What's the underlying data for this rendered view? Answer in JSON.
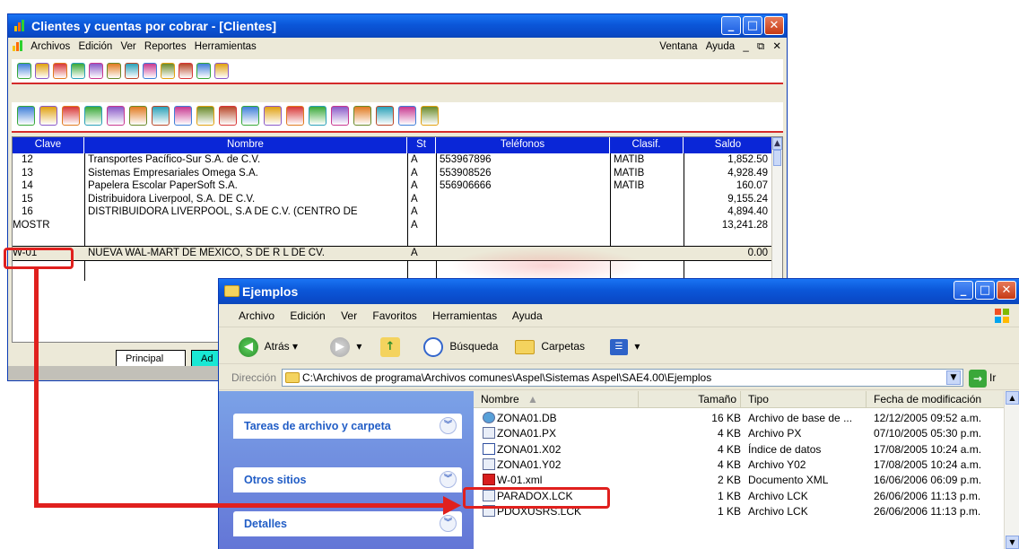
{
  "app_window": {
    "title": "Clientes y cuentas por cobrar - [Clientes]",
    "controls": [
      "_",
      "□",
      "✕"
    ],
    "menu": [
      "Archivos",
      "Edición",
      "Ver",
      "Reportes",
      "Herramientas"
    ],
    "menu_right": [
      "Ventana",
      "Ayuda",
      "_",
      "⧉",
      "✕"
    ],
    "toolbar1_icons": [
      "clients-icon",
      "report-icon",
      "user-money-icon",
      "doc-icon",
      "doc-money-icon",
      "transfer-icon",
      "pos-icon",
      "user-icon",
      "gear-icon",
      "book-icon",
      "user-alert-icon",
      "exit-icon"
    ],
    "toolbar2_icons": [
      "new-icon",
      "edit-icon",
      "delete-icon",
      "search-icon",
      "filter-icon",
      "refresh-icon",
      "print-icon",
      "preview-icon",
      "report-icon",
      "user-money-icon",
      "cancel-icon",
      "money-icon",
      "sum-icon",
      "next-icon",
      "relations-icon",
      "user-icon",
      "import-icon",
      "export-icon",
      "notes-icon"
    ],
    "table": {
      "columns": [
        "Clave",
        "Nombre",
        "St",
        "Teléfonos",
        "Clasif.",
        "Saldo"
      ],
      "rows": [
        {
          "clave": "12",
          "nombre": "Transportes Pacífico-Sur S.A. de C.V.",
          "st": "A",
          "tel": "553967896",
          "clasif": "MATIB",
          "saldo": "1,852.50"
        },
        {
          "clave": "13",
          "nombre": "Sistemas Empresariales Omega S.A.",
          "st": "A",
          "tel": "553908526",
          "clasif": "MATIB",
          "saldo": "4,928.49"
        },
        {
          "clave": "14",
          "nombre": "Papelera Escolar PaperSoft S.A.",
          "st": "A",
          "tel": "556906666",
          "clasif": "MATIB",
          "saldo": "160.07"
        },
        {
          "clave": "15",
          "nombre": "Distribuidora Liverpool, S.A. DE C.V.",
          "st": "A",
          "tel": "",
          "clasif": "",
          "saldo": "9,155.24"
        },
        {
          "clave": "16",
          "nombre": "DISTRIBUIDORA LIVERPOOL, S.A DE C.V. (CENTRO DE",
          "st": "A",
          "tel": "",
          "clasif": "",
          "saldo": "4,894.40"
        },
        {
          "clave": "MOSTR",
          "nombre": "",
          "st": "A",
          "tel": "",
          "clasif": "",
          "saldo": "13,241.28"
        },
        {
          "clave": "W-01",
          "nombre": "NUEVA WAL-MART DE MEXICO, S DE R L DE CV.",
          "st": "A",
          "tel": "",
          "clasif": "",
          "saldo": "0.00"
        }
      ]
    },
    "tabs": [
      "Principal",
      "Ad"
    ],
    "colors": {
      "header_bg": "#0a26d7",
      "active_tab": "#19e8d4",
      "toolbar_rule": "#d32b2b"
    }
  },
  "explorer": {
    "title": "Ejemplos",
    "controls": [
      "_",
      "□",
      "✕"
    ],
    "menu": [
      "Archivo",
      "Edición",
      "Ver",
      "Favoritos",
      "Herramientas",
      "Ayuda"
    ],
    "toolbar": {
      "back": "Atrás",
      "search": "Búsqueda",
      "folders": "Carpetas"
    },
    "address": {
      "label": "Dirección",
      "path": "C:\\Archivos de programa\\Archivos comunes\\Aspel\\Sistemas Aspel\\SAE4.00\\Ejemplos",
      "go": "Ir"
    },
    "tasks": [
      "Tareas de archivo y carpeta",
      "Otros sitios",
      "Detalles"
    ],
    "columns": [
      "Nombre",
      "Tamaño",
      "Tipo",
      "Fecha de modificación"
    ],
    "files": [
      {
        "name": "ZONA01.DB",
        "size": "16 KB",
        "type": "Archivo de base de ...",
        "date": "12/12/2005 09:52 a.m.",
        "icon": "db"
      },
      {
        "name": "ZONA01.PX",
        "size": "4 KB",
        "type": "Archivo PX",
        "date": "07/10/2005 05:30 p.m.",
        "icon": "file"
      },
      {
        "name": "ZONA01.X02",
        "size": "4 KB",
        "type": "Índice de datos",
        "date": "17/08/2005 10:24 a.m.",
        "icon": "idx"
      },
      {
        "name": "ZONA01.Y02",
        "size": "4 KB",
        "type": "Archivo Y02",
        "date": "17/08/2005 10:24 a.m.",
        "icon": "file"
      },
      {
        "name": "W-01.xml",
        "size": "2 KB",
        "type": "Documento XML",
        "date": "16/06/2006 06:09 p.m.",
        "icon": "xml"
      },
      {
        "name": "PARADOX.LCK",
        "size": "1 KB",
        "type": "Archivo LCK",
        "date": "26/06/2006 11:13 p.m.",
        "icon": "file"
      },
      {
        "name": "PDOXUSRS.LCK",
        "size": "1 KB",
        "type": "Archivo LCK",
        "date": "26/06/2006 11:13 p.m.",
        "icon": "file"
      }
    ]
  },
  "annotation_color": "#e0201e"
}
